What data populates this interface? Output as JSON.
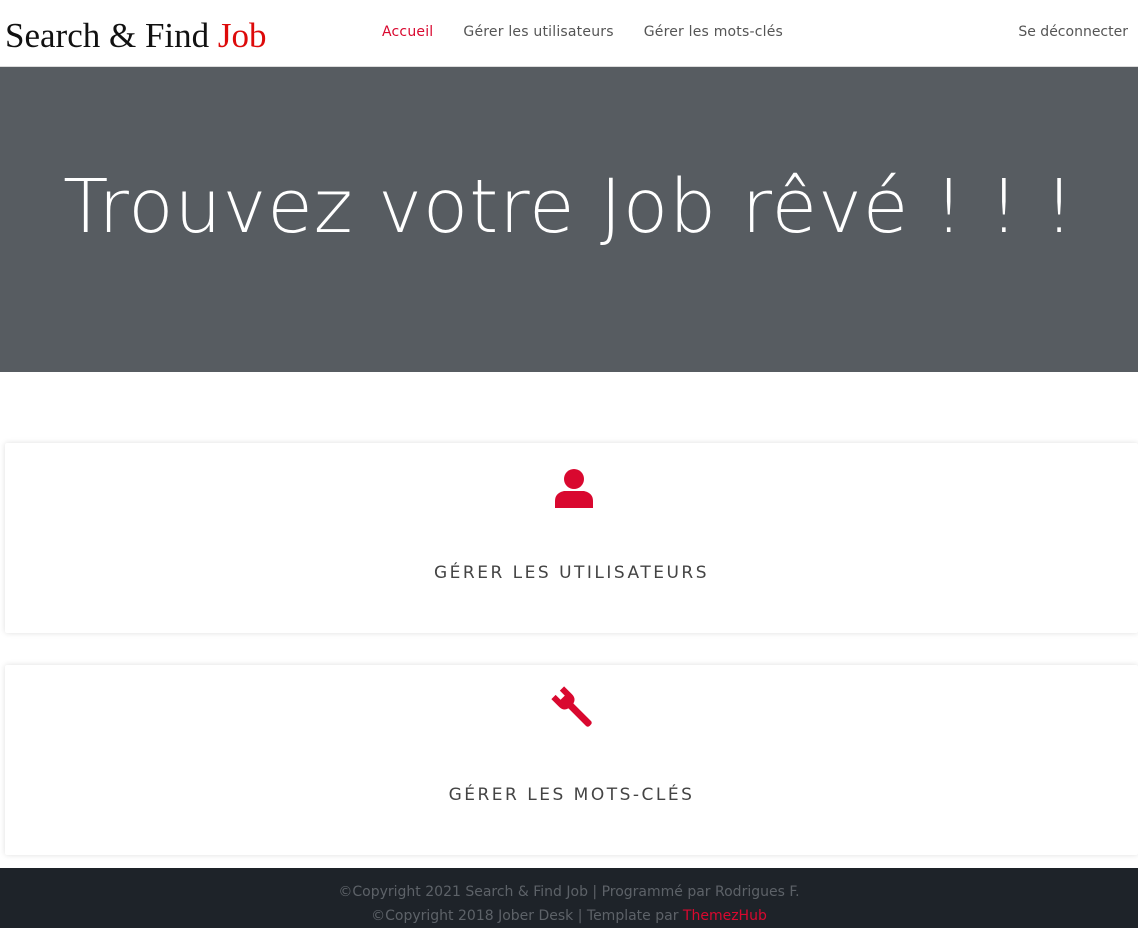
{
  "brand": {
    "name": "Search & Find ",
    "accent": "Job"
  },
  "nav": {
    "items": [
      {
        "label": "Accueil",
        "active": true
      },
      {
        "label": "Gérer les utilisateurs",
        "active": false
      },
      {
        "label": "Gérer les mots-clés",
        "active": false
      }
    ],
    "logout_label": "Se déconnecter"
  },
  "hero": {
    "title": "Trouvez votre Job rêvé ! ! !"
  },
  "cards": [
    {
      "icon": "user-icon",
      "label": "GÉRER LES UTILISATEURS"
    },
    {
      "icon": "wrench-icon",
      "label": "GÉRER LES MOTS-CLÉS"
    }
  ],
  "footer": {
    "line1": "©Copyright 2021 Search & Find Job | Programmé par Rodrigues F.",
    "line2_prefix": "©Copyright 2018 Jober Desk | Template par ",
    "line2_link": "ThemezHub"
  },
  "colors": {
    "accent": "#d9082f",
    "logo_accent": "#dd0a0a",
    "hero_bg": "#575c61",
    "footer_bg": "#1e2329"
  }
}
